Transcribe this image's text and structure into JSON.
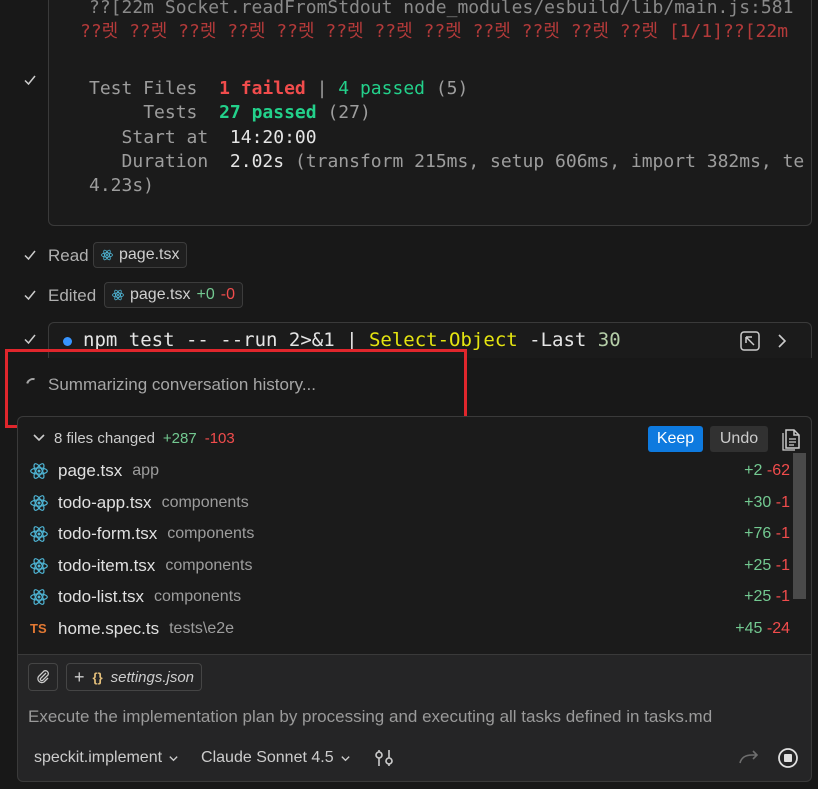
{
  "terminal": {
    "line_socket": "??[22m Socket.readFromStdout node_modules/esbuild/lib/main.js:581",
    "line_garbled": "??렛 ??렛 ??렛 ??렛 ??렛 ??렛 ??렛 ??렛 ??렛 ??렛 ??렛 ??렛 [1/1]??[22m",
    "test_files_label": "Test Files",
    "test_files_failed": "1 failed",
    "test_files_sep": "|",
    "test_files_passed": "4 passed",
    "test_files_total": "(5)",
    "tests_label": "Tests",
    "tests_passed": "27 passed",
    "tests_total": "(27)",
    "start_label": "Start at",
    "start_value": "14:20:00",
    "duration_label": "Duration",
    "duration_value": "2.02s",
    "duration_detail": "(transform 215ms, setup 606ms, import 382ms, te",
    "duration_wrap": "4.23s)"
  },
  "steps": {
    "read_label": "Read",
    "read_file": "page.tsx",
    "edited_label": "Edited",
    "edited_file": "page.tsx",
    "edited_plus": "+0",
    "edited_minus": "-0"
  },
  "command": {
    "part1": "npm test -- --run 2>&1 | ",
    "part2": "Select-Object",
    "part3": " -Last ",
    "part4": "30"
  },
  "status": {
    "summarizing": "Summarizing conversation history..."
  },
  "changes": {
    "summary": "8 files changed",
    "plus": "+287",
    "minus": "-103",
    "keep_label": "Keep",
    "undo_label": "Undo",
    "files": [
      {
        "name": "page.tsx",
        "dir": "app",
        "plus": "+2",
        "minus": "-62",
        "icon": "react-icon"
      },
      {
        "name": "todo-app.tsx",
        "dir": "components",
        "plus": "+30",
        "minus": "-1",
        "icon": "react-icon"
      },
      {
        "name": "todo-form.tsx",
        "dir": "components",
        "plus": "+76",
        "minus": "-1",
        "icon": "react-icon"
      },
      {
        "name": "todo-item.tsx",
        "dir": "components",
        "plus": "+25",
        "minus": "-1",
        "icon": "react-icon"
      },
      {
        "name": "todo-list.tsx",
        "dir": "components",
        "plus": "+25",
        "minus": "-1",
        "icon": "react-icon"
      },
      {
        "name": "home.spec.ts",
        "dir": "tests\\e2e",
        "plus": "+45",
        "minus": "-24",
        "icon": "ts-icon"
      }
    ],
    "ts_badge": "TS"
  },
  "input": {
    "context_file": "settings.json",
    "prompt_text": "Execute the implementation plan by processing and executing all tasks defined in tasks.md",
    "mode": "speckit.implement",
    "model": "Claude Sonnet 4.5"
  },
  "colors": {
    "accent": "#0e7adf",
    "added": "#73c991",
    "removed": "#f14c4c",
    "highlight": "#e0262c"
  }
}
